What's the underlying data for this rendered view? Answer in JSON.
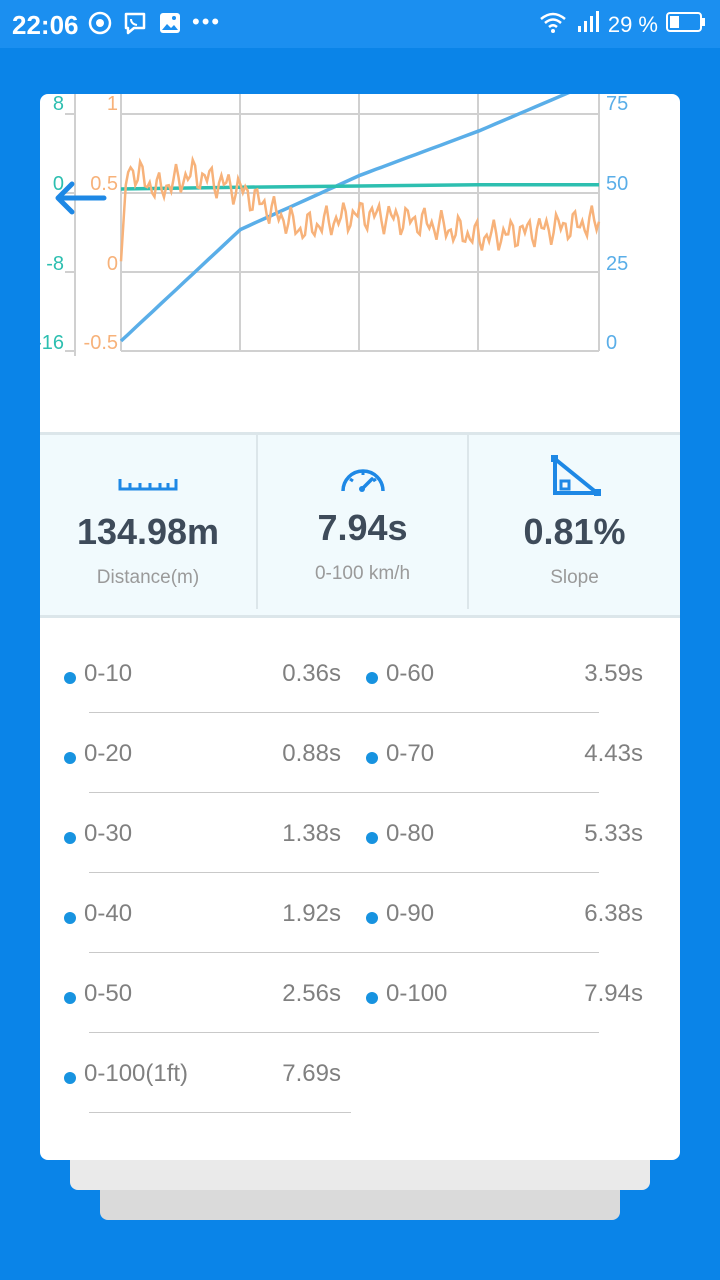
{
  "status_bar": {
    "time": "22:06",
    "battery_text": "29 %",
    "left_icons": [
      "chrome-icon",
      "viber-icon",
      "gallery-icon",
      "more-dots-icon"
    ],
    "right_icons": [
      "wifi-icon",
      "signal-icon",
      "battery-icon"
    ]
  },
  "chart_data": {
    "type": "line",
    "left_axis_outer": {
      "ticks": [
        "8",
        "0",
        "-8",
        "-16"
      ],
      "color": "#2DBFB0"
    },
    "left_axis_inner": {
      "ticks": [
        "1",
        "0.5",
        "0",
        "-0.5"
      ],
      "color": "#F7B27A"
    },
    "right_axis": {
      "ticks": [
        "75",
        "50",
        "25",
        "0"
      ],
      "color": "#5AAEE8"
    },
    "grid": true,
    "series": [
      {
        "color": "#5AAEE8",
        "axis": "right",
        "description_hidden": true,
        "x": [
          0,
          1,
          2,
          3,
          4
        ],
        "values": [
          0,
          35,
          52,
          66,
          82
        ]
      },
      {
        "color": "#2DBFB0",
        "axis": "left_outer",
        "x": [
          0,
          1,
          2,
          3,
          4
        ],
        "values": [
          0,
          0.3,
          0.5,
          0.7,
          0.7
        ]
      },
      {
        "color": "#F7B27A",
        "axis": "left_inner",
        "x": [
          0,
          0.05,
          0.3,
          0.6,
          1,
          1.5,
          2,
          2.5,
          3,
          3.5,
          4
        ],
        "values": [
          0,
          0.6,
          0.45,
          0.55,
          0.45,
          0.2,
          0.3,
          0.25,
          0.15,
          0.2,
          0.25
        ]
      }
    ]
  },
  "stats": {
    "distance": {
      "value": "134.98m",
      "label": "Distance(m)",
      "icon": "ruler-icon"
    },
    "accel": {
      "value": "7.94s",
      "label": "0-100 km/h",
      "icon": "speedometer-icon"
    },
    "slope": {
      "value": "0.81%",
      "label": "Slope",
      "icon": "slope-icon"
    }
  },
  "times": [
    {
      "left": {
        "label": "0-10",
        "value": "0.36s"
      },
      "right": {
        "label": "0-60",
        "value": "3.59s"
      }
    },
    {
      "left": {
        "label": "0-20",
        "value": "0.88s"
      },
      "right": {
        "label": "0-70",
        "value": "4.43s"
      }
    },
    {
      "left": {
        "label": "0-30",
        "value": "1.38s"
      },
      "right": {
        "label": "0-80",
        "value": "5.33s"
      }
    },
    {
      "left": {
        "label": "0-40",
        "value": "1.92s"
      },
      "right": {
        "label": "0-90",
        "value": "6.38s"
      }
    },
    {
      "left": {
        "label": "0-50",
        "value": "2.56s"
      },
      "right": {
        "label": "0-100",
        "value": "7.94s"
      }
    },
    {
      "left": {
        "label": "0-100(1ft)",
        "value": "7.69s"
      }
    }
  ]
}
